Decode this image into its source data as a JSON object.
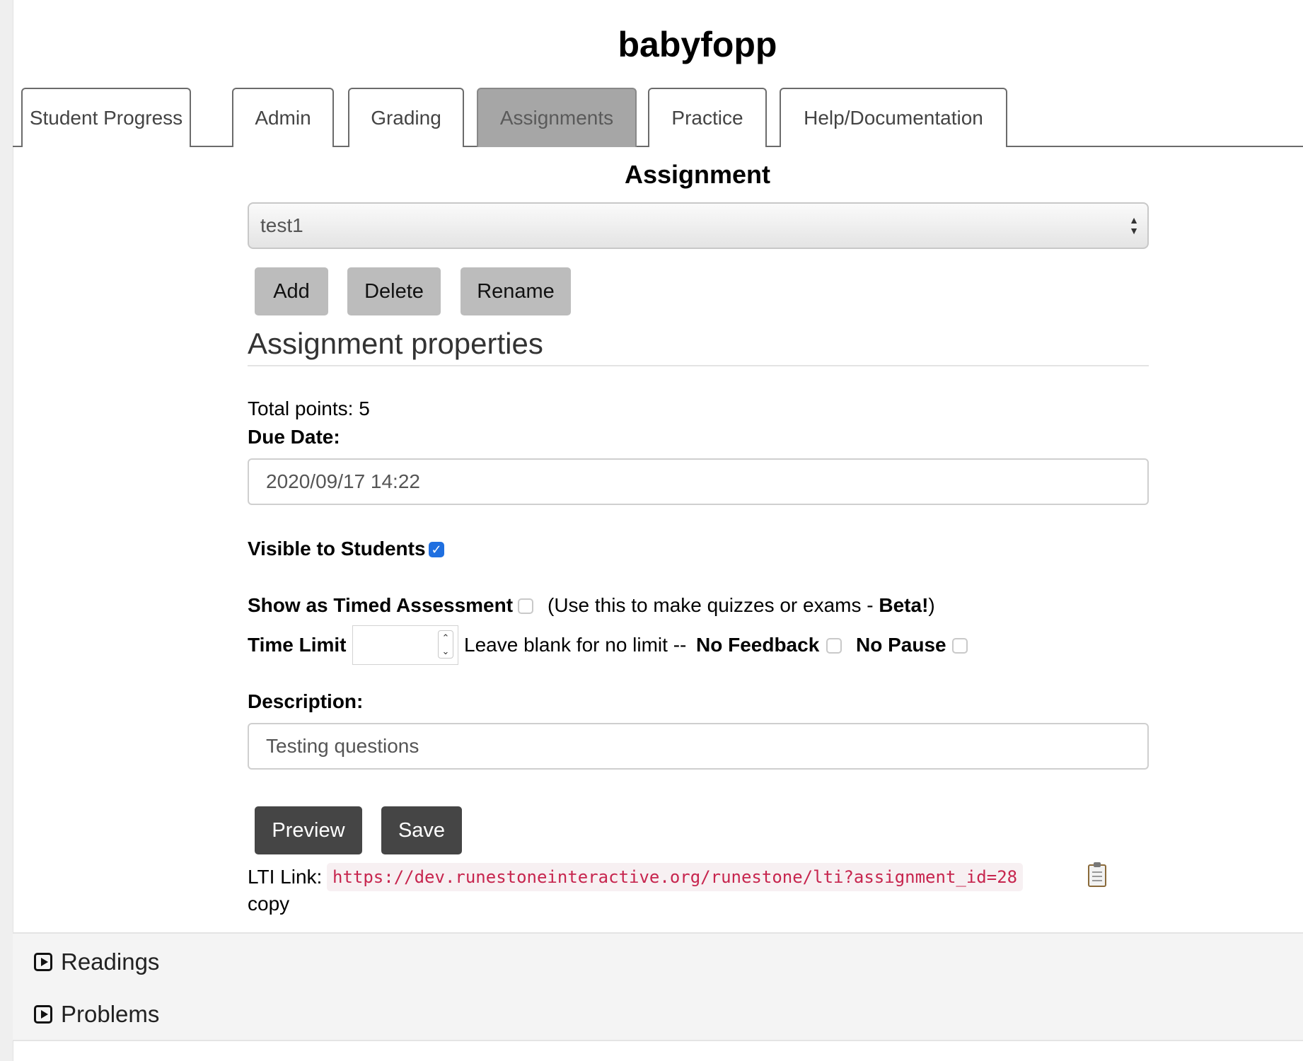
{
  "course": {
    "title": "babyfopp"
  },
  "tabs": [
    {
      "label": "Student Progress"
    },
    {
      "label": "Admin"
    },
    {
      "label": "Grading"
    },
    {
      "label": "Assignments",
      "active": true
    },
    {
      "label": "Practice"
    },
    {
      "label": "Help/Documentation"
    }
  ],
  "assignment": {
    "heading": "Assignment",
    "selected": "test1",
    "buttons": {
      "add": "Add",
      "delete": "Delete",
      "rename": "Rename"
    }
  },
  "properties": {
    "heading": "Assignment properties",
    "total_points_label": "Total points:",
    "total_points_value": "5",
    "due_date_label": "Due Date:",
    "due_date_value": "2020/09/17 14:22",
    "visible_label": "Visible to Students",
    "visible_checked": true,
    "timed_label": "Show as Timed Assessment",
    "timed_checked": false,
    "timed_note_prefix": "(Use this to make quizzes or exams -",
    "timed_note_bold": "Beta!",
    "timed_note_suffix": ")",
    "time_limit_label": "Time Limit",
    "time_limit_value": "",
    "time_limit_hint": "Leave blank for no limit --",
    "no_feedback_label": "No Feedback",
    "no_feedback_checked": false,
    "no_pause_label": "No Pause",
    "no_pause_checked": false,
    "description_label": "Description:",
    "description_value": "Testing questions"
  },
  "actions": {
    "preview": "Preview",
    "save": "Save"
  },
  "lti": {
    "label": "LTI Link:",
    "url": "https://dev.runestoneinteractive.org/runestone/lti?assignment_id=28",
    "copy_label": "copy"
  },
  "panels": [
    {
      "label": "Readings"
    },
    {
      "label": "Problems"
    }
  ],
  "colors": {
    "active_tab": "#a6a6a6",
    "gray_button": "#bcbcbc",
    "dark_button": "#454545",
    "checkbox_checked": "#1f6fe0",
    "lti_link_text": "#c7254e"
  },
  "icons": [
    "checkmark-icon",
    "spinner-up-icon",
    "spinner-down-icon",
    "clipboard-icon",
    "play-square-icon"
  ]
}
